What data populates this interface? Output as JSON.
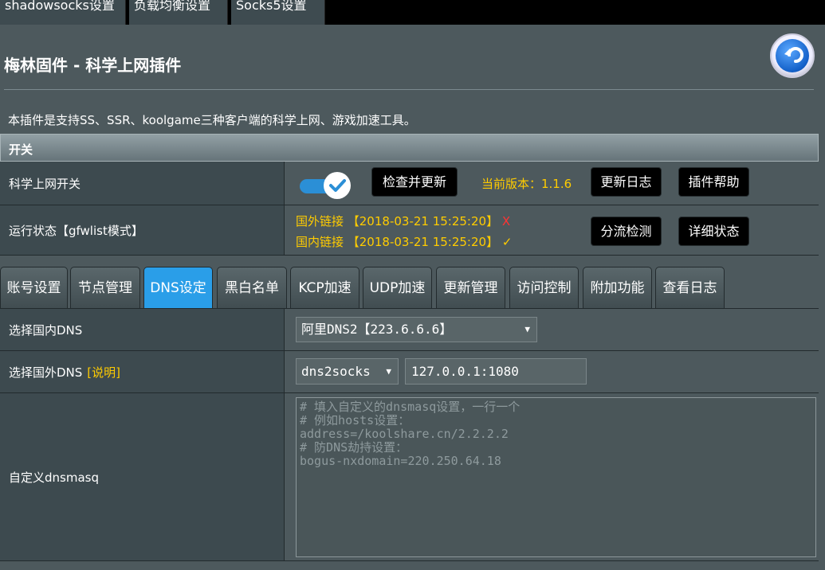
{
  "top_tabs": [
    "shadowsocks设置",
    "负载均衡设置",
    "Socks5设置"
  ],
  "page_title": "梅林固件 - 科学上网插件",
  "description": "本插件是支持SS、SSR、koolgame三种客户端的科学上网、游戏加速工具。",
  "switch_section": {
    "header": "开关",
    "switch_label": "科学上网开关",
    "check_update_button": "检查并更新",
    "version_text": "当前版本：1.1.6",
    "changelog_button": "更新日志",
    "help_button": "插件帮助",
    "status_label": "运行状态【gfwlist模式】",
    "foreign_status": "国外链接 【2018-03-21 15:25:20】",
    "foreign_mark": "X",
    "domestic_status": "国内链接 【2018-03-21 15:25:20】",
    "domestic_mark": "✓",
    "split_check_button": "分流检测",
    "detail_button": "详细状态"
  },
  "sub_tabs": [
    {
      "label": "账号设置",
      "active": false
    },
    {
      "label": "节点管理",
      "active": false
    },
    {
      "label": "DNS设定",
      "active": true
    },
    {
      "label": "黑白名单",
      "active": false
    },
    {
      "label": "KCP加速",
      "active": false
    },
    {
      "label": "UDP加速",
      "active": false
    },
    {
      "label": "更新管理",
      "active": false
    },
    {
      "label": "访问控制",
      "active": false
    },
    {
      "label": "附加功能",
      "active": false
    },
    {
      "label": "查看日志",
      "active": false
    }
  ],
  "dns": {
    "domestic_label": "选择国内DNS",
    "domestic_value": "阿里DNS2【223.6.6.6】",
    "foreign_label": "选择国外DNS",
    "foreign_explain": "[说明]",
    "foreign_mode": "dns2socks",
    "foreign_server": "127.0.0.1:1080",
    "dnsmasq_label": "自定义dnsmasq",
    "dnsmasq_placeholder": "# 填入自定义的dnsmasq设置，一行一个\n# 例如hosts设置：\naddress=/koolshare.cn/2.2.2.2\n# 防DNS劫持设置：\nbogus-nxdomain=220.250.64.18"
  },
  "colors": {
    "accent": "#2a9ee8",
    "highlight": "#ffcc00",
    "error": "#ff3333"
  }
}
